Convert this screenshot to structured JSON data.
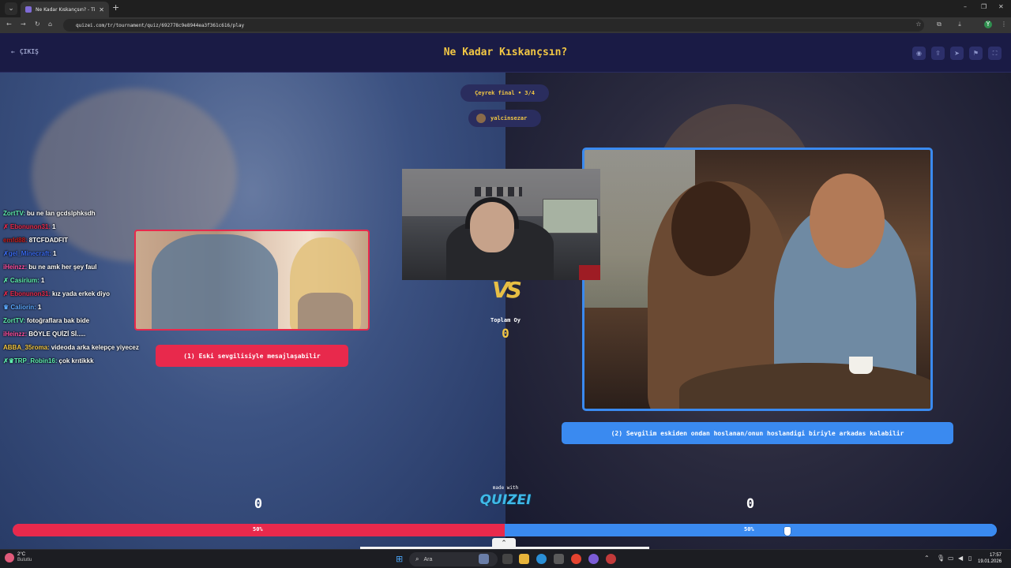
{
  "browser": {
    "tab_title": "Ne Kadar Kıskançsın? - Tier Lis",
    "url": "quizei.com/tr/tournament/quiz/692778c9e8944ea3f361c616/play"
  },
  "header": {
    "exit_label": "ÇIKIŞ",
    "title": "Ne Kadar Kıskançsın?"
  },
  "round": {
    "label": "Çeyrek final • 3/4",
    "user": "yalcinsezar"
  },
  "chat": [
    {
      "user": "ZortTV:",
      "text": "bu ne lan gcdslphksdh",
      "color": "#5ff0b0"
    },
    {
      "user": "✗ Ebonunon31:",
      "text": "1",
      "color": "#e8294c"
    },
    {
      "user": "emfd88:",
      "text": "8TCFDADFIT",
      "color": "#c21d1d"
    },
    {
      "user": "✗gel_Minecraft:",
      "text": "1",
      "color": "#3a6bf0"
    },
    {
      "user": "iHeinzz:",
      "text": "bu ne amk her şey faul",
      "color": "#ff4fa0"
    },
    {
      "user": "✗ Casirium:",
      "text": "1",
      "color": "#5ff0b0"
    },
    {
      "user": "✗ Ebonunon31:",
      "text": "kız yada erkek diyo",
      "color": "#e8294c"
    },
    {
      "user": "♛ Caliorin:",
      "text": "1",
      "color": "#5ba8ff"
    },
    {
      "user": "ZortTV:",
      "text": "fotoğraflara bak bide",
      "color": "#5ff0b0"
    },
    {
      "user": "iHeinzz:",
      "text": "BÖYLE QUİZİ Sİ.....",
      "color": "#ff4fa0"
    },
    {
      "user": "ABBA_35roma:",
      "text": "videoda arka kelepçe yiyecez",
      "color": "#f2c744"
    },
    {
      "user": "✗♛TRP_Robin16:",
      "text": "çok krıtikkk",
      "color": "#5ff0b0"
    }
  ],
  "choices": {
    "left_label": "(1) Eski sevgilisiyle mesajlaşabilir",
    "right_label": "(2) Sevgilim eskiden ondan hoslanan/onun hoslandigi biriyle arkadas kalabilir",
    "left_score": "0",
    "right_score": "0",
    "left_pct_value": 50,
    "right_pct_value": 50,
    "left_pct": "50%",
    "right_pct": "50%"
  },
  "vs": {
    "text": "VS",
    "total_label": "Toplam Oy",
    "total_value": "0"
  },
  "branding": {
    "made_with": "made with",
    "logo": "QUIZEI"
  },
  "taskbar": {
    "temp": "2°C",
    "weather": "Bulutlu",
    "search": "Ara",
    "time": "17:57",
    "date": "19.01.2026"
  },
  "colors": {
    "accent_yellow": "#f2c744",
    "left_red": "#e8294c",
    "right_blue": "#3a8af0",
    "header_bg": "#1a1b45"
  }
}
